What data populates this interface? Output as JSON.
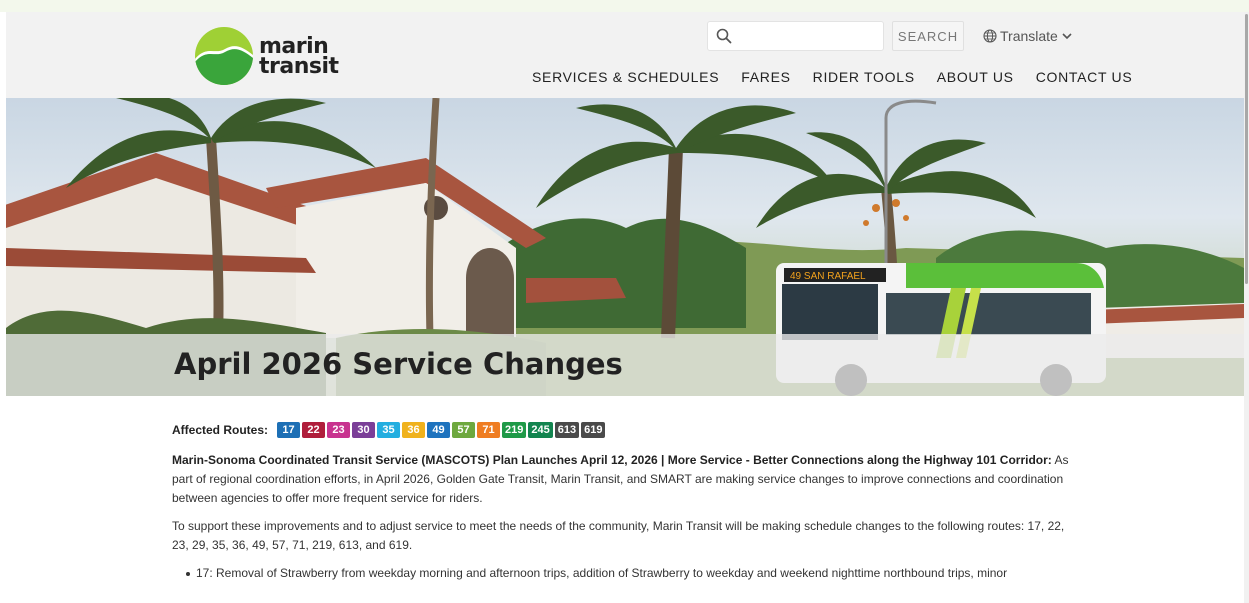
{
  "brand": {
    "line1": "marin",
    "line2": "transit",
    "green_dark": "#3aa53b",
    "green_light": "#9fd035"
  },
  "search": {
    "placeholder": "",
    "button_label": "SEARCH"
  },
  "translate": {
    "label": "Translate"
  },
  "nav": [
    {
      "label": "SERVICES & SCHEDULES"
    },
    {
      "label": "FARES"
    },
    {
      "label": "RIDER TOOLS"
    },
    {
      "label": "ABOUT US"
    },
    {
      "label": "CONTACT US"
    }
  ],
  "hero": {
    "title": "April 2026 Service Changes",
    "bus_sign": "49  SAN RAFAEL"
  },
  "content": {
    "affected_label": "Affected Routes:",
    "routes": [
      {
        "num": "17",
        "color": "#1d6fb5"
      },
      {
        "num": "22",
        "color": "#b01e3b"
      },
      {
        "num": "23",
        "color": "#c8338f"
      },
      {
        "num": "30",
        "color": "#7b3f98"
      },
      {
        "num": "35",
        "color": "#23aee0"
      },
      {
        "num": "36",
        "color": "#f0b21d"
      },
      {
        "num": "49",
        "color": "#1e73be"
      },
      {
        "num": "57",
        "color": "#6ea83e"
      },
      {
        "num": "71",
        "color": "#ef7d22"
      },
      {
        "num": "219",
        "color": "#1f9a48"
      },
      {
        "num": "245",
        "color": "#12844f"
      },
      {
        "num": "613",
        "color": "#4a4a4a"
      },
      {
        "num": "619",
        "color": "#4a4a4a"
      }
    ],
    "p1_bold": "Marin-Sonoma Coordinated Transit Service (MASCOTS) Plan Launches April 12, 2026 | More Service - Better Connections along the Highway 101 Corridor:",
    "p1_rest": " As part of regional coordination efforts, in April 2026, Golden Gate Transit, Marin Transit, and SMART are making service changes to improve connections and coordination between agencies to offer more frequent service for riders.",
    "p2": "To support these improvements and to adjust service to meet the needs of the community, Marin Transit will be making schedule changes to the following routes: 17, 22, 23, 29, 35, 36, 49, 57, 71, 219, 613, and 619.",
    "bullets": [
      "17: Removal of Strawberry from weekday morning and afternoon trips, addition of Strawberry to weekday and weekend nighttime northbound trips, minor"
    ]
  }
}
